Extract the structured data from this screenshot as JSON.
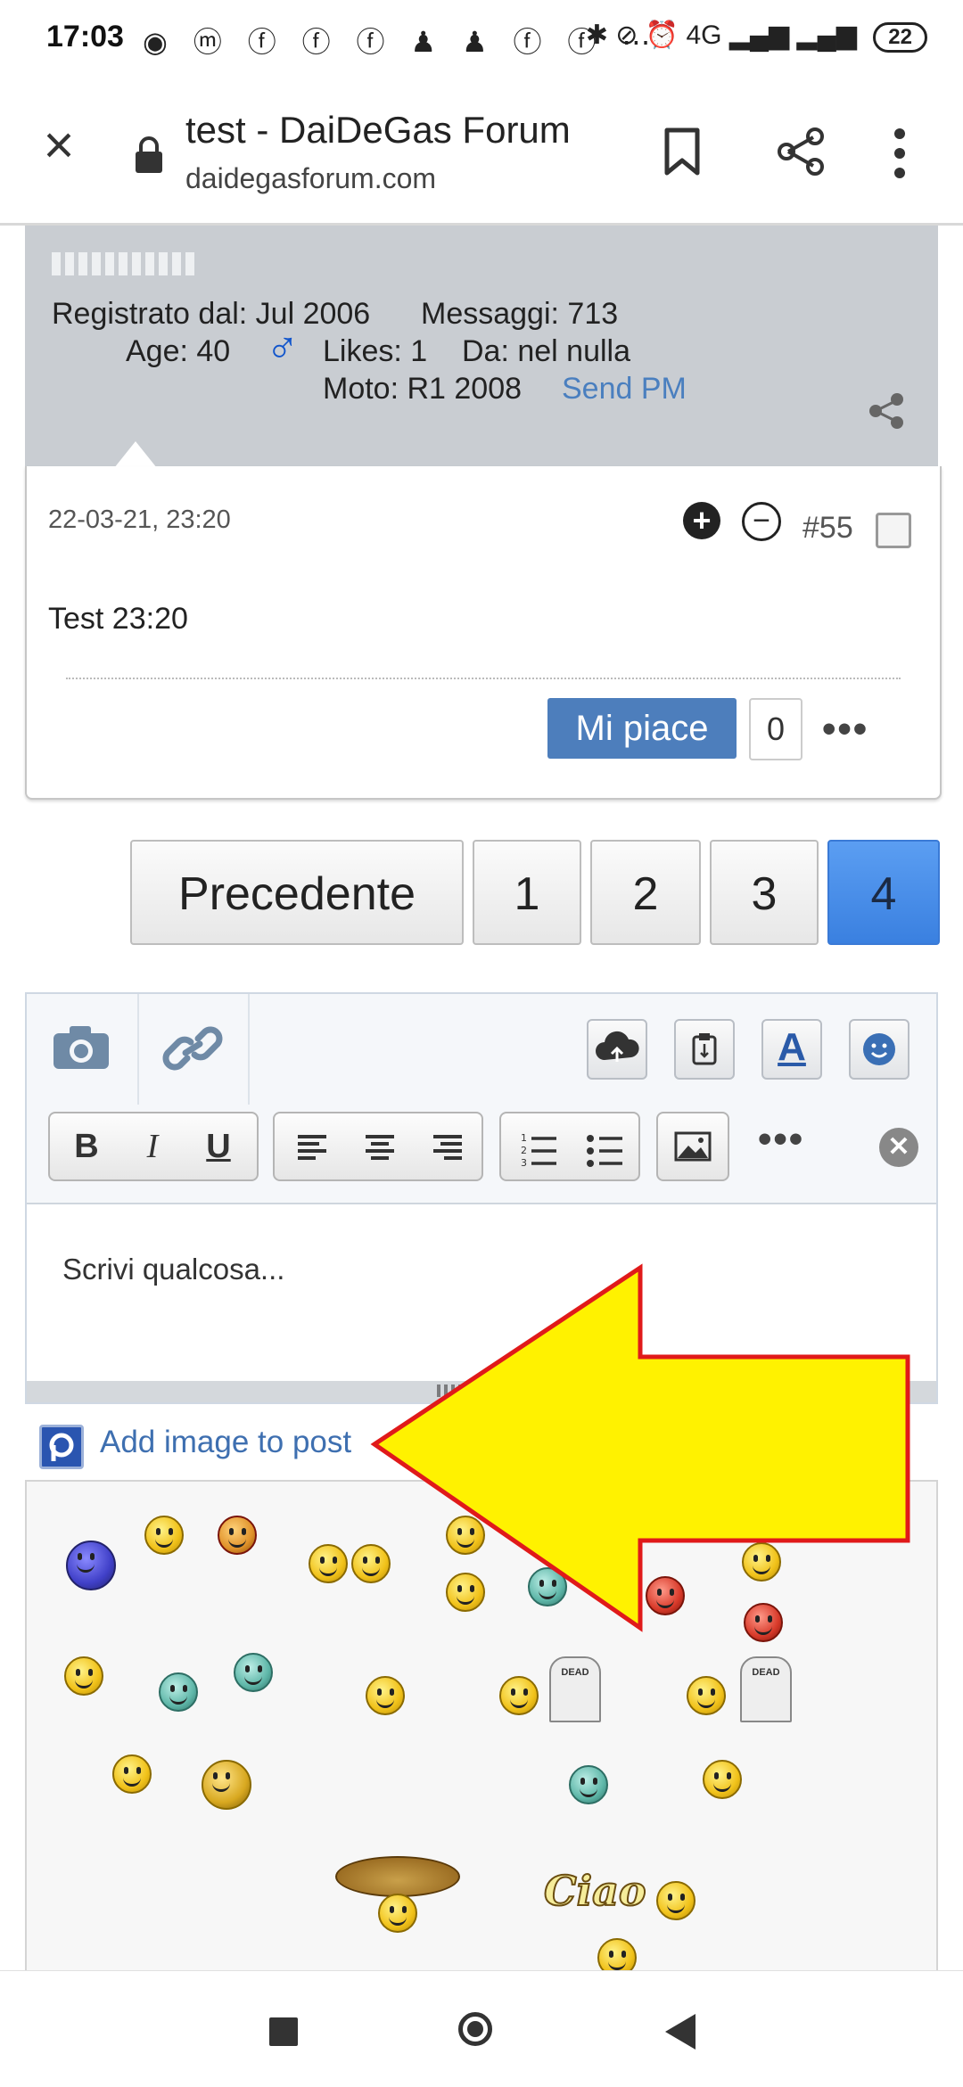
{
  "status_bar": {
    "time": "17:03",
    "notification_icons": "◉ ⓜ ⓕ ⓕ ⓕ ♟ ♟ ⓕ ⓕ ⋯",
    "right_icons": "✱ ⊘ ⏰ 4G ▂▄▆ ▂▄▆",
    "battery": "22"
  },
  "browser": {
    "title": "test - DaiDeGas Forum",
    "url": "daidegasforum.com",
    "icons": [
      "close-icon",
      "lock-icon",
      "bookmark-icon",
      "share-icon",
      "more-vert-icon"
    ]
  },
  "profile": {
    "registered": "Registrato dal: Jul 2006",
    "messages": "Messaggi: 713",
    "age": "Age: 40",
    "gender_symbol": "♂",
    "likes": "Likes: 1",
    "from": "Da: nel nulla",
    "bike": "Moto: R1 2008",
    "send_pm": "Send PM"
  },
  "post": {
    "date": "22-03-21, 23:20",
    "plus": "+",
    "minus": "−",
    "number": "#55",
    "body": "Test 23:20",
    "like_label": "Mi piace",
    "like_count": "0",
    "more": "•••"
  },
  "pagination": {
    "prev_label": "Precedente",
    "pages": [
      "1",
      "2",
      "3",
      "4"
    ],
    "active_page": "4"
  },
  "editor": {
    "bold": "B",
    "italic": "I",
    "underline": "U",
    "more": "•••",
    "clear": "✕",
    "font_color_label": "A",
    "placeholder": "Scrivi qualcosa..."
  },
  "add_image": {
    "label": "Add image to post"
  },
  "smileys": {
    "dead_label": "DEAD",
    "ciao_text": "Ciao"
  },
  "colors": {
    "accent_blue": "#4d7ebc",
    "active_page": "#4a8ee8",
    "profile_bg": "#c9cdd2",
    "arrow_fill": "#fff200",
    "arrow_stroke": "#e01a1a"
  }
}
